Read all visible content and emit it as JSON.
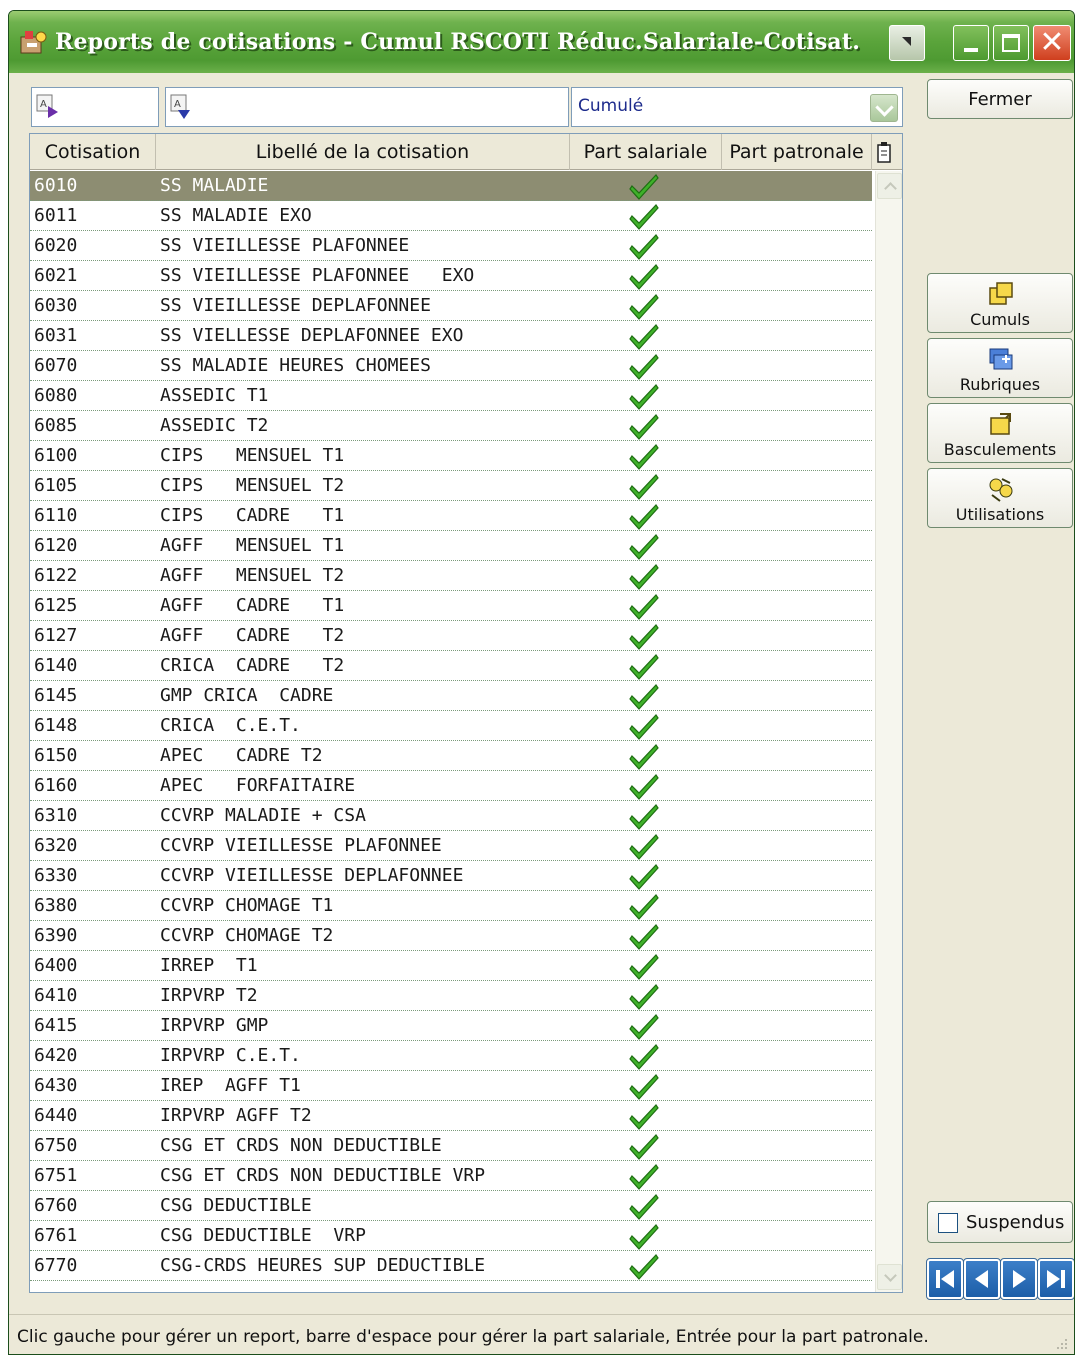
{
  "window": {
    "title": "Reports de cotisations - Cumul RSCOTI Réduc.Salariale-Cotisat."
  },
  "filters": {
    "code_value": "",
    "label_value": "",
    "mode_value": "Cumulé"
  },
  "grid": {
    "columns": [
      "Cotisation",
      "Libellé de la cotisation",
      "Part salariale",
      "Part patronale"
    ],
    "rows": [
      {
        "code": "6010",
        "label": "SS MALADIE",
        "salariale": true,
        "selected": true
      },
      {
        "code": "6011",
        "label": "SS MALADIE EXO",
        "salariale": true
      },
      {
        "code": "6020",
        "label": "SS VIEILLESSE PLAFONNEE",
        "salariale": true
      },
      {
        "code": "6021",
        "label": "SS VIEILLESSE PLAFONNEE   EXO",
        "salariale": true
      },
      {
        "code": "6030",
        "label": "SS VIEILLESSE DEPLAFONNEE",
        "salariale": true
      },
      {
        "code": "6031",
        "label": "SS VIELLESSE DEPLAFONNEE EXO",
        "salariale": true
      },
      {
        "code": "6070",
        "label": "SS MALADIE HEURES CHOMEES",
        "salariale": true
      },
      {
        "code": "6080",
        "label": "ASSEDIC T1",
        "salariale": true
      },
      {
        "code": "6085",
        "label": "ASSEDIC T2",
        "salariale": true
      },
      {
        "code": "6100",
        "label": "CIPS   MENSUEL T1",
        "salariale": true
      },
      {
        "code": "6105",
        "label": "CIPS   MENSUEL T2",
        "salariale": true
      },
      {
        "code": "6110",
        "label": "CIPS   CADRE   T1",
        "salariale": true
      },
      {
        "code": "6120",
        "label": "AGFF   MENSUEL T1",
        "salariale": true
      },
      {
        "code": "6122",
        "label": "AGFF   MENSUEL T2",
        "salariale": true
      },
      {
        "code": "6125",
        "label": "AGFF   CADRE   T1",
        "salariale": true
      },
      {
        "code": "6127",
        "label": "AGFF   CADRE   T2",
        "salariale": true
      },
      {
        "code": "6140",
        "label": "CRICA  CADRE   T2",
        "salariale": true
      },
      {
        "code": "6145",
        "label": "GMP CRICA  CADRE",
        "salariale": true
      },
      {
        "code": "6148",
        "label": "CRICA  C.E.T.",
        "salariale": true
      },
      {
        "code": "6150",
        "label": "APEC   CADRE T2",
        "salariale": true
      },
      {
        "code": "6160",
        "label": "APEC   FORFAITAIRE",
        "salariale": true
      },
      {
        "code": "6310",
        "label": "CCVRP MALADIE + CSA",
        "salariale": true
      },
      {
        "code": "6320",
        "label": "CCVRP VIEILLESSE PLAFONNEE",
        "salariale": true
      },
      {
        "code": "6330",
        "label": "CCVRP VIEILLESSE DEPLAFONNEE",
        "salariale": true
      },
      {
        "code": "6380",
        "label": "CCVRP CHOMAGE T1",
        "salariale": true
      },
      {
        "code": "6390",
        "label": "CCVRP CHOMAGE T2",
        "salariale": true
      },
      {
        "code": "6400",
        "label": "IRREP  T1",
        "salariale": true
      },
      {
        "code": "6410",
        "label": "IRPVRP T2",
        "salariale": true
      },
      {
        "code": "6415",
        "label": "IRPVRP GMP",
        "salariale": true
      },
      {
        "code": "6420",
        "label": "IRPVRP C.E.T.",
        "salariale": true
      },
      {
        "code": "6430",
        "label": "IREP  AGFF T1",
        "salariale": true
      },
      {
        "code": "6440",
        "label": "IRPVRP AGFF T2",
        "salariale": true
      },
      {
        "code": "6750",
        "label": "CSG ET CRDS NON DEDUCTIBLE",
        "salariale": true
      },
      {
        "code": "6751",
        "label": "CSG ET CRDS NON DEDUCTIBLE VRP",
        "salariale": true
      },
      {
        "code": "6760",
        "label": "CSG DEDUCTIBLE",
        "salariale": true
      },
      {
        "code": "6761",
        "label": "CSG DEDUCTIBLE  VRP",
        "salariale": true
      },
      {
        "code": "6770",
        "label": "CSG-CRDS HEURES SUP DEDUCTIBLE",
        "salariale": true
      }
    ]
  },
  "buttons": {
    "fermer": "Fermer",
    "cumuls": "Cumuls",
    "rubriques": "Rubriques",
    "basculements": "Basculements",
    "utilisations": "Utilisations",
    "suspendus": "Suspendus"
  },
  "suspendus_checked": false,
  "icons": {
    "check": "checkmark-icon",
    "nav": [
      "first-record-icon",
      "previous-record-icon",
      "next-record-icon",
      "last-record-icon"
    ]
  },
  "colors": {
    "title_bar": "#5aa43b",
    "selected_row": "#8d8d72",
    "check": "#3fb02a",
    "combo_text": "#1d2b8c",
    "nav_button": "#1c5ea8"
  },
  "status": {
    "message": "Clic gauche pour gérer un report, barre d'espace pour gérer la part salariale, Entrée pour la part patronale."
  }
}
